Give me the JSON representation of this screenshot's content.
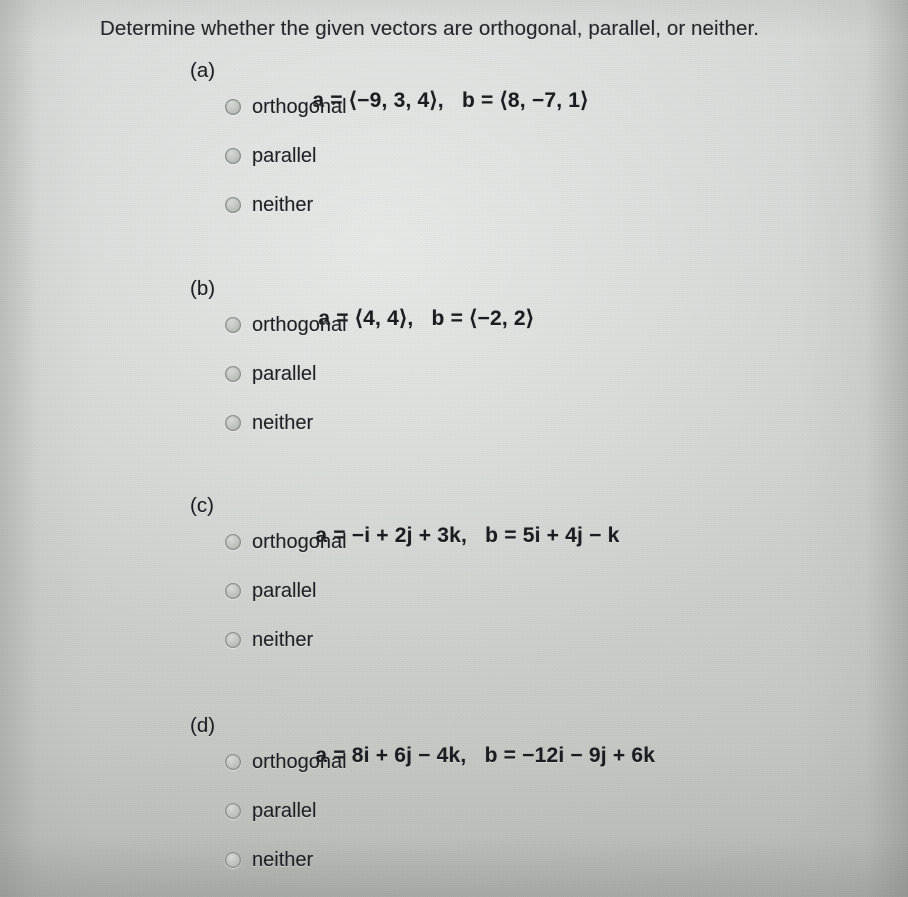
{
  "prompt": "Determine whether the given vectors are orthogonal, parallel, or neither.",
  "options_template": [
    "orthogonal",
    "parallel",
    "neither"
  ],
  "questions": [
    {
      "label": "(a)",
      "expression": "a = ⟨−9, 3, 4⟩,   b = ⟨8, −7, 1⟩",
      "vector_a": "a = ⟨−9, 3, 4⟩,",
      "vector_b": "b = ⟨8, −7, 1⟩",
      "options": [
        {
          "label": "orthogonal",
          "selected": false
        },
        {
          "label": "parallel",
          "selected": false
        },
        {
          "label": "neither",
          "selected": false
        }
      ]
    },
    {
      "label": "(b)",
      "expression": "a = ⟨4, 4⟩,   b = ⟨−2, 2⟩",
      "vector_a": "a = ⟨4, 4⟩,",
      "vector_b": "b = ⟨−2, 2⟩",
      "options": [
        {
          "label": "orthogonal",
          "selected": false
        },
        {
          "label": "parallel",
          "selected": false
        },
        {
          "label": "neither",
          "selected": false
        }
      ]
    },
    {
      "label": "(c)",
      "expression": "a = −i + 2j + 3k,   b = 5i + 4j − k",
      "vector_a": "a = −i + 2j + 3k,",
      "vector_b": "b = 5i + 4j − k",
      "options": [
        {
          "label": "orthogonal",
          "selected": false
        },
        {
          "label": "parallel",
          "selected": false
        },
        {
          "label": "neither",
          "selected": false
        }
      ]
    },
    {
      "label": "(d)",
      "expression": "a = 8i + 6j − 4k,   b = −12i − 9j + 6k",
      "vector_a": "a = 8i + 6j − 4k,",
      "vector_b": "b = −12i − 9j + 6k",
      "options": [
        {
          "label": "orthogonal",
          "selected": false
        },
        {
          "label": "parallel",
          "selected": false
        },
        {
          "label": "neither",
          "selected": false
        }
      ]
    }
  ],
  "colors": {
    "background": "#cbcfcb",
    "text": "#1c1f23",
    "radio_fill": "#c2c7c2",
    "radio_border": "#8b908b"
  }
}
